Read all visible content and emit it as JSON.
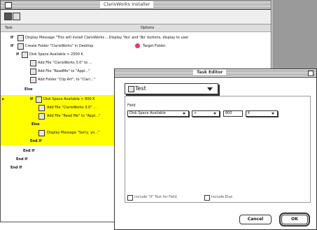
{
  "installer": {
    "title": "ClarisWorks Installer",
    "columns": {
      "task": "Task",
      "options": "Options"
    },
    "rows": [
      {
        "text": "Display Message \"This will install ClarisWorks ...Display 'Yes' and 'No' buttons, display to user"
      },
      {
        "text": "Create Folder \"ClarisWorks\" in Desktop",
        "option": "Target Folder"
      },
      {
        "keyword": "If",
        "text": "Disk Space Available > 2500 K"
      },
      {
        "text": "Add File \"ClarisWorks 3.0\" to ..."
      },
      {
        "text": "Add File \"ReadMe\" to \"Appl...\""
      },
      {
        "text": "Add Folder \"Clip Art\", to \"Clari...\""
      },
      {
        "keyword": "Else"
      },
      {
        "keyword": "If",
        "text": "Disk Space Available > 800 K"
      },
      {
        "text": "Add File \"ClarisWorks 3.0\" ..."
      },
      {
        "text": "Add File \"Read Me\" to \"Appl...\""
      },
      {
        "keyword": "Else"
      },
      {
        "text": "Display Message \"Sorry, yo...\""
      },
      {
        "keyword": "End If"
      },
      {
        "keyword": "End If"
      },
      {
        "keyword": "End If"
      },
      {
        "keyword": "End If"
      }
    ]
  },
  "editor": {
    "title": "Task Editor",
    "task_type": "Test",
    "field_label": "Field",
    "condition": {
      "field": "Disk Space Available",
      "operator": ">",
      "value": "800",
      "unit": "K"
    },
    "checkbox_true": "Include \"If\" Test for Field",
    "checkbox_else": "Include Else",
    "cancel_label": "Cancel",
    "ok_label": "OK"
  }
}
